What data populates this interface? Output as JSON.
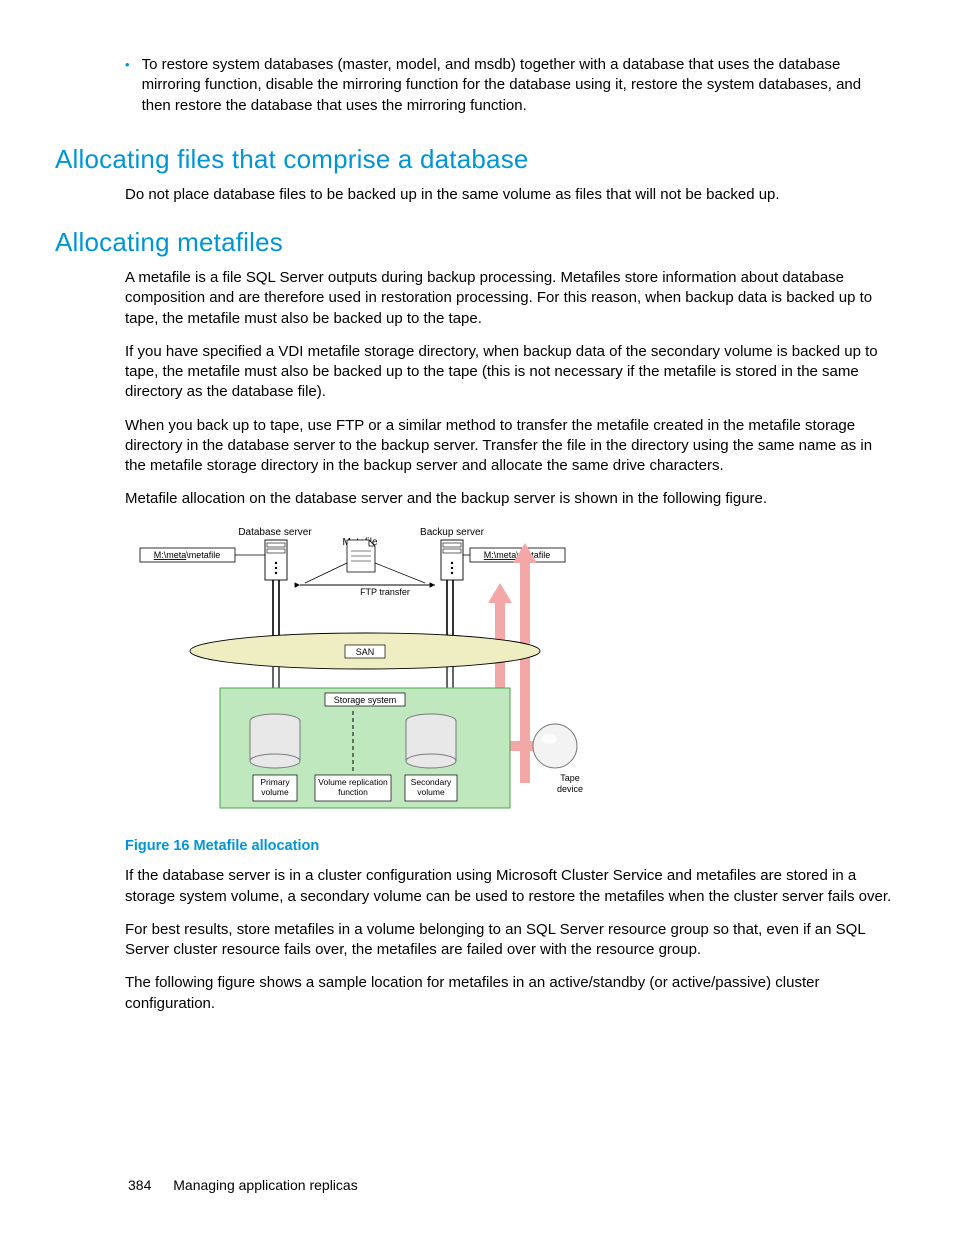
{
  "bullet1": "To restore system databases (master, model, and msdb) together with a database that uses the database mirroring function, disable the mirroring function for the database using it, restore the system databases, and then restore the database that uses the mirroring function.",
  "h_files": "Allocating files that comprise a database",
  "p_files_1": "Do not place database files to be backed up in the same volume as files that will not be backed up.",
  "h_meta": "Allocating metafiles",
  "p_meta_1": "A metafile is a file SQL Server outputs during backup processing. Metafiles store information about database composition and are therefore used in restoration processing. For this reason, when backup data is backed up to tape, the metafile must also be backed up to the tape.",
  "p_meta_2": "If you have specified a VDI metafile storage directory, when backup data of the secondary volume is backed up to tape, the metafile must also be backed up to the tape (this is not necessary if the metafile is stored in the same directory as the database file).",
  "p_meta_3": "When you back up to tape, use FTP or a similar method to transfer the metafile created in the metafile storage directory in the database server to the backup server. Transfer the file in the directory using the same name as in the metafile storage directory in the backup server and allocate the same drive characters.",
  "p_meta_4": "Metafile allocation on the database server and the backup server is shown in the following figure.",
  "fig_caption": "Figure 16 Metafile allocation",
  "p_after_1": "If the database server is in a cluster configuration using Microsoft Cluster Service and metafiles are stored in a storage system volume, a secondary volume can be used to restore the metafiles when the cluster server fails over.",
  "p_after_2": "For best results, store metafiles in a volume belonging to an SQL Server resource group so that, even if an SQL Server cluster resource fails over, the metafiles are failed over with the resource group.",
  "p_after_3": "The following figure shows a sample location for metafiles in an active/standby (or active/passive) cluster configuration.",
  "footer_page": "384",
  "footer_text": "Managing application replicas",
  "diagram": {
    "db_server": "Database server",
    "bk_server": "Backup server",
    "metafile": "Metafile",
    "path_left": "M:\\meta\\metafile",
    "path_right": "M:\\meta\\metafile",
    "ftp": "FTP transfer",
    "san": "SAN",
    "storage": "Storage system",
    "primary": "Primary volume",
    "replication": "Volume replication function",
    "secondary": "Secondary volume",
    "tape": "Tape device"
  }
}
